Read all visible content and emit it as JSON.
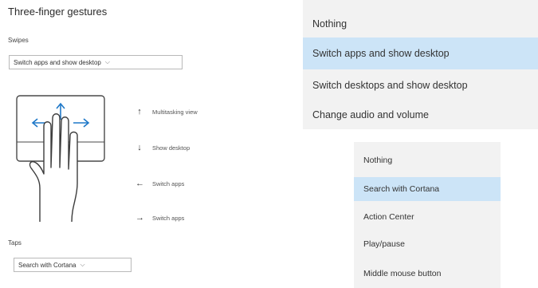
{
  "section_title": "Three-finger gestures",
  "swipes": {
    "label": "Swipes",
    "value": "Switch apps and show desktop"
  },
  "taps": {
    "label": "Taps",
    "value": "Search with Cortana"
  },
  "gestures": [
    {
      "icon": "arrow-up-icon",
      "glyph": "↑",
      "label": "Multitasking view"
    },
    {
      "icon": "arrow-down-icon",
      "glyph": "↓",
      "label": "Show desktop"
    },
    {
      "icon": "arrow-left-icon",
      "glyph": "←",
      "label": "Switch apps"
    },
    {
      "icon": "arrow-right-icon",
      "glyph": "→",
      "label": "Switch apps"
    }
  ],
  "swipes_dropdown": {
    "options": [
      "Nothing",
      "Switch apps and show desktop",
      "Switch desktops and show desktop",
      "Change audio and volume"
    ],
    "selected_index": 1
  },
  "taps_dropdown": {
    "options": [
      "Nothing",
      "Search with Cortana",
      "Action Center",
      "Play/pause",
      "Middle mouse button"
    ],
    "selected_index": 1
  },
  "colors": {
    "selected_bg": "#cce4f7",
    "dropdown_bg": "#f2f2f2"
  }
}
